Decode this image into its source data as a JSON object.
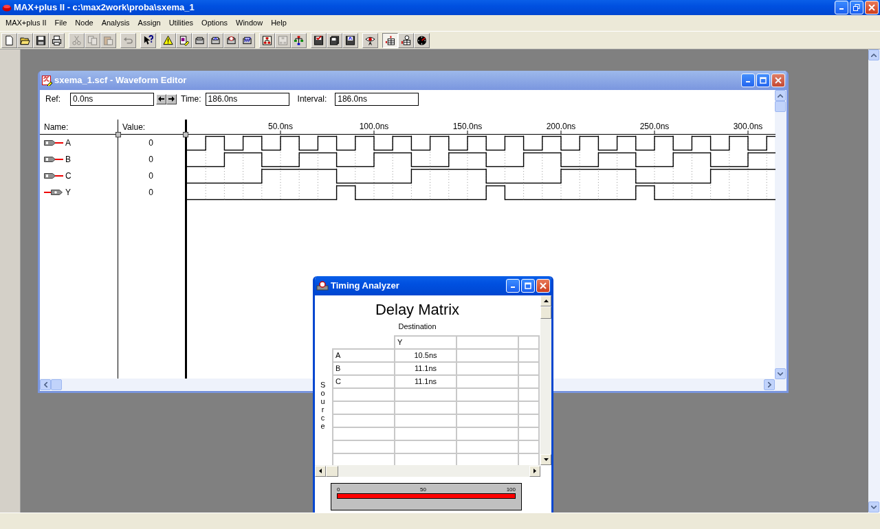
{
  "app": {
    "title": "MAX+plus II - c:\\max2work\\proba\\sxema_1"
  },
  "menu": [
    "MAX+plus II",
    "File",
    "Node",
    "Analysis",
    "Assign",
    "Utilities",
    "Options",
    "Window",
    "Help"
  ],
  "toolbar": [
    [
      {
        "disabled": false,
        "pressed": false
      },
      {
        "disabled": false,
        "pressed": false
      },
      {
        "disabled": false,
        "pressed": false
      },
      {
        "disabled": false,
        "pressed": false
      }
    ],
    [
      {
        "disabled": true,
        "pressed": false
      },
      {
        "disabled": true,
        "pressed": false
      },
      {
        "disabled": true,
        "pressed": false
      }
    ],
    [
      {
        "disabled": true,
        "pressed": false
      }
    ],
    [
      {
        "disabled": false,
        "pressed": false
      }
    ],
    [
      {
        "disabled": false,
        "pressed": false
      },
      {
        "disabled": false,
        "pressed": false
      },
      {
        "disabled": false,
        "pressed": false
      },
      {
        "disabled": false,
        "pressed": false
      },
      {
        "disabled": false,
        "pressed": false
      },
      {
        "disabled": false,
        "pressed": false
      }
    ],
    [
      {
        "disabled": false,
        "pressed": false
      },
      {
        "disabled": true,
        "pressed": false
      },
      {
        "disabled": false,
        "pressed": false
      }
    ],
    [
      {
        "disabled": false,
        "pressed": false
      },
      {
        "disabled": false,
        "pressed": false
      },
      {
        "disabled": false,
        "pressed": false
      }
    ],
    [
      {
        "disabled": false,
        "pressed": false
      }
    ],
    [
      {
        "disabled": false,
        "pressed": true
      },
      {
        "disabled": false,
        "pressed": false
      },
      {
        "disabled": false,
        "pressed": false
      }
    ]
  ],
  "waveform_editor": {
    "title": "sxema_1.scf - Waveform Editor",
    "active": false,
    "ref_label": "Ref:",
    "ref": "0.0ns",
    "time_label": "Time:",
    "time": "186.0ns",
    "interval_label": "Interval:",
    "interval": "186.0ns",
    "name_header": "Name:",
    "value_header": "Value:",
    "time_ticks": [
      "50.0ns",
      "100.0ns",
      "150.0ns",
      "200.0ns",
      "250.0ns",
      "300.0ns"
    ],
    "signals": [
      {
        "name": "A",
        "kind": "input",
        "value": "0",
        "high": [
          false,
          true,
          false,
          true,
          false,
          true,
          false,
          true,
          false,
          true,
          false,
          true,
          false,
          true,
          false,
          true,
          false,
          true,
          false,
          true,
          false,
          true,
          false,
          true,
          false,
          true,
          false,
          true,
          false,
          true,
          false,
          true
        ]
      },
      {
        "name": "B",
        "kind": "input",
        "value": "0",
        "high": [
          false,
          false,
          true,
          true,
          false,
          false,
          true,
          true,
          false,
          false,
          true,
          true,
          false,
          false,
          true,
          true,
          false,
          false,
          true,
          true,
          false,
          false,
          true,
          true,
          false,
          false,
          true,
          true,
          false,
          false,
          true,
          true
        ]
      },
      {
        "name": "C",
        "kind": "input",
        "value": "0",
        "high": [
          false,
          false,
          false,
          false,
          true,
          true,
          true,
          true,
          false,
          false,
          false,
          false,
          true,
          true,
          true,
          true,
          false,
          false,
          false,
          false,
          true,
          true,
          true,
          true,
          false,
          false,
          false,
          false,
          true,
          true,
          true,
          true
        ]
      },
      {
        "name": "Y",
        "kind": "output",
        "value": "0",
        "high": [
          false,
          false,
          false,
          false,
          false,
          false,
          false,
          false,
          true,
          false,
          false,
          false,
          false,
          false,
          false,
          false,
          true,
          false,
          false,
          false,
          false,
          false,
          false,
          false,
          true,
          false,
          false,
          false,
          false,
          false,
          false,
          false
        ]
      }
    ]
  },
  "timing_analyzer": {
    "title": "Timing Analyzer",
    "active": true,
    "heading": "Delay Matrix",
    "destination_label": "Destination",
    "source_label": "Source",
    "columns": [
      "Y"
    ],
    "rows": [
      {
        "source": "A",
        "delays": [
          "10.5ns"
        ]
      },
      {
        "source": "B",
        "delays": [
          "11.1ns"
        ]
      },
      {
        "source": "C",
        "delays": [
          "11.1ns"
        ]
      }
    ],
    "meter": {
      "labels": [
        "0",
        "50",
        "100"
      ],
      "level": 1
    }
  }
}
